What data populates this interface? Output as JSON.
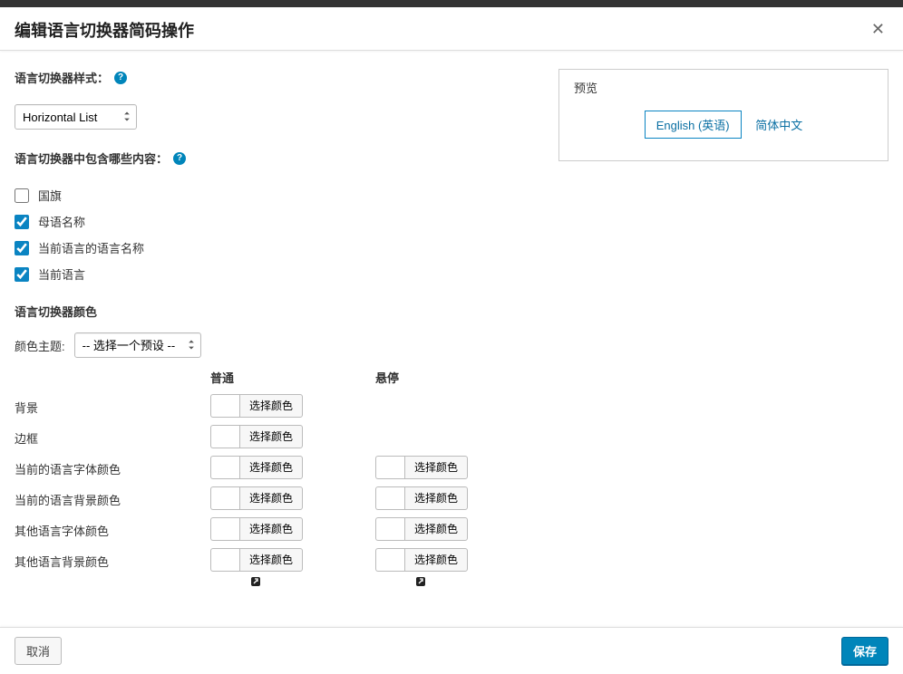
{
  "header": {
    "title": "编辑语言切换器简码操作"
  },
  "style": {
    "label": "语言切换器样式：",
    "selected": "Horizontal List"
  },
  "include": {
    "label": "语言切换器中包含哪些内容：",
    "options": [
      {
        "label": "国旗",
        "checked": false
      },
      {
        "label": "母语名称",
        "checked": true
      },
      {
        "label": "当前语言的语言名称",
        "checked": true
      },
      {
        "label": "当前语言",
        "checked": true
      }
    ]
  },
  "colors": {
    "title": "语言切换器颜色",
    "theme_label": "颜色主题:",
    "theme_selected": "-- 选择一个预设 --",
    "col_normal": "普通",
    "col_hover": "悬停",
    "pick_label": "选择颜色",
    "rows": [
      {
        "label": "背景",
        "hover": false
      },
      {
        "label": "边框",
        "hover": false
      },
      {
        "label": "当前的语言字体颜色",
        "hover": true
      },
      {
        "label": "当前的语言背景颜色",
        "hover": true
      },
      {
        "label": "其他语言字体颜色",
        "hover": true
      },
      {
        "label": "其他语言背景颜色",
        "hover": true
      }
    ]
  },
  "preview": {
    "title": "预览",
    "current": "English (英语)",
    "other": "简体中文"
  },
  "footer": {
    "cancel": "取消",
    "save": "保存"
  }
}
